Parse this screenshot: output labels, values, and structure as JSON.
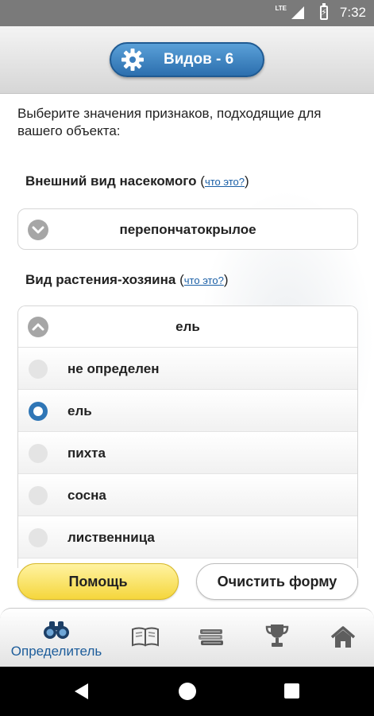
{
  "status_bar": {
    "network": "LTE",
    "time": "7:32"
  },
  "header": {
    "species_button_label": "Видов - 6"
  },
  "intro_text": "Выберите значения признаков, подходящие для вашего объекта:",
  "questions": [
    {
      "label": "Внешний вид насекомого",
      "help_link": "что это?",
      "selected_value": "перепончатокрылое",
      "expanded": false
    },
    {
      "label": "Вид растения-хозяина",
      "help_link": "что это?",
      "selected_value": "ель",
      "expanded": true,
      "options": [
        {
          "label": "не определен",
          "selected": false
        },
        {
          "label": "ель",
          "selected": true
        },
        {
          "label": "пихта",
          "selected": false
        },
        {
          "label": "сосна",
          "selected": false
        },
        {
          "label": "лиственница",
          "selected": false
        }
      ]
    }
  ],
  "buttons": {
    "help": "Помощь",
    "clear": "Очистить форму"
  },
  "tabbar": {
    "items": [
      {
        "label": "Определитель",
        "icon": "binoculars-icon",
        "active": true
      },
      {
        "label": "",
        "icon": "book-icon",
        "active": false
      },
      {
        "label": "",
        "icon": "books-stack-icon",
        "active": false
      },
      {
        "label": "",
        "icon": "trophy-icon",
        "active": false
      },
      {
        "label": "",
        "icon": "home-icon",
        "active": false
      }
    ]
  },
  "colors": {
    "accent_blue": "#2f76b6",
    "help_yellow": "#f5d63c",
    "link_blue": "#1a5fa6"
  }
}
